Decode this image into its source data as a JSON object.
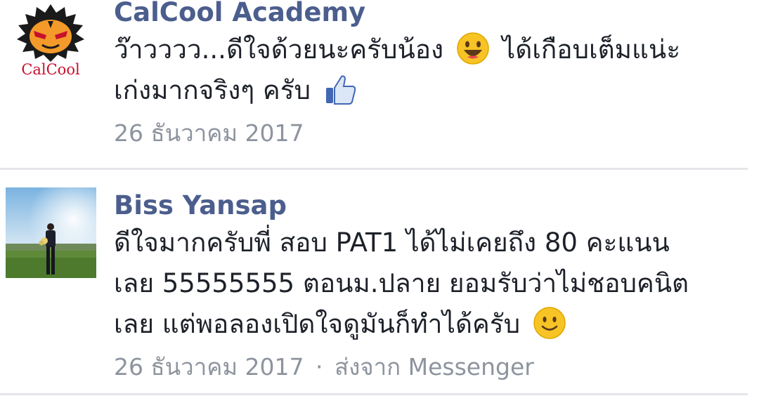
{
  "comments": [
    {
      "author": "CalCool Academy",
      "avatar_text": "CalCool",
      "avatar_icon": "calcool-logo-icon",
      "text_line1_a": "ว๊าวววว...ดีใจด้วยนะครับน้อง",
      "emoji1": "grinning-face-icon",
      "text_line1_b": "ได้เกือบเต็มแน่ะ",
      "text_line2_a": "เก่งมากจริงๆ ครับ",
      "emoji2": "thumbs-up-icon",
      "date": "26 ธันวาคม 2017"
    },
    {
      "author": "Biss Yansap",
      "avatar_icon": "profile-photo-icon",
      "text_line1": "ดีใจมากครับพี่ สอบ PAT1 ได้ไม่เคยถึง 80 คะแนน",
      "text_line2": "เลย 55555555 ตอนม.ปลาย ยอมรับว่าไม่ชอบคนิต",
      "text_line3_a": "เลย แต่พอลองเปิดใจดูมันก็ทำได้ครับ",
      "emoji": "slightly-smiling-face-icon",
      "date": "26 ธันวาคม 2017",
      "separator": "·",
      "source": "ส่งจาก Messenger"
    }
  ],
  "colors": {
    "author": "#4b5e8d",
    "text": "#1d2129",
    "meta": "#8d949e",
    "divider": "#e4e6ea"
  }
}
